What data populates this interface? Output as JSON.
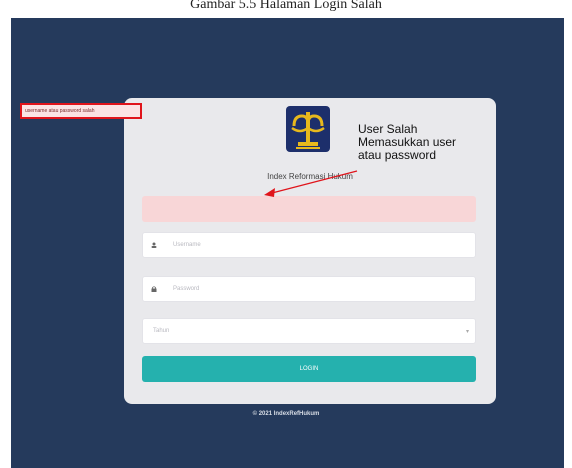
{
  "caption": "Gambar 5.5 Halaman Login Salah",
  "app": {
    "title": "Index Reformasi Hukum"
  },
  "alert": {
    "message": "username atau password salah"
  },
  "form": {
    "username_placeholder": "Username",
    "password_placeholder": "Password",
    "select_value": "Tahun",
    "login_label": "LOGIN"
  },
  "footer": "© 2021 IndexRefHukum",
  "annotation": {
    "line1": "User Salah",
    "line2": "Memasukkan user",
    "line3": "atau password"
  },
  "colors": {
    "background": "#253a5c",
    "card": "#e9e9ec",
    "button": "#25b1ae",
    "alert": "#f8d6d7",
    "highlight": "#e0141b"
  }
}
